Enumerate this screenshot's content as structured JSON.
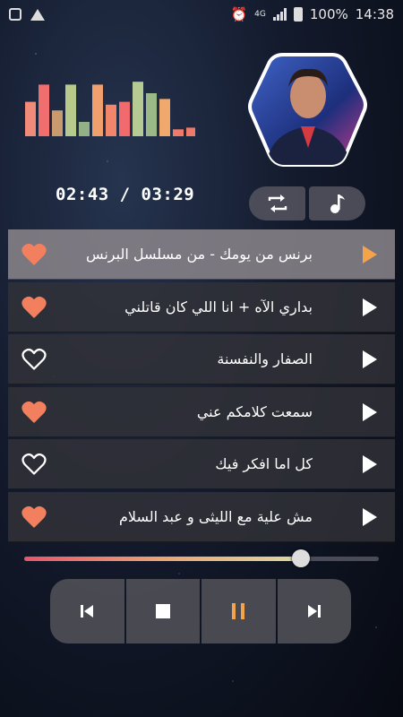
{
  "status_bar": {
    "network": "4G",
    "battery": "100%",
    "time": "14:38",
    "icons": [
      "gallery-icon",
      "drive-icon",
      "alarm-icon",
      "signal-icon",
      "battery-icon"
    ]
  },
  "player": {
    "elapsed": "02:43",
    "separator": " / ",
    "duration": "03:29",
    "progress_fraction": 0.78,
    "accent_color": "#f5a34a",
    "heart_color": "#f2805e"
  },
  "equalizer": {
    "levels": [
      0.6,
      0.9,
      0.45,
      0.9,
      0.25,
      0.9,
      0.55,
      0.6,
      0.95,
      0.75,
      0.65,
      0.12,
      0.15
    ],
    "colors": [
      "#f08a79",
      "#f06e6e",
      "#c89a6d",
      "#b7c98b",
      "#94b087",
      "#f0a06d",
      "#f2866a",
      "#f06a6e",
      "#b6cb93",
      "#9bb887",
      "#f0a86c",
      "#f07a6a",
      "#f07a6a"
    ]
  },
  "top_buttons": [
    {
      "name": "repeat-button",
      "icon": "repeat-icon"
    },
    {
      "name": "music-note-button",
      "icon": "music-note-icon"
    }
  ],
  "songs": [
    {
      "title": "برنس من يومك - من مسلسل البرنس",
      "favorite": true,
      "active": true
    },
    {
      "title": "بداري الآه + انا اللي كان قاتلني",
      "favorite": true,
      "active": false
    },
    {
      "title": "الصفار والنفسنة",
      "favorite": false,
      "active": false
    },
    {
      "title": "سمعت كلامكم عني",
      "favorite": true,
      "active": false
    },
    {
      "title": "كل اما افكر فيك",
      "favorite": false,
      "active": false
    },
    {
      "title": "مش علية مع الليثى و عبد السلام",
      "favorite": true,
      "active": false
    }
  ],
  "controls": [
    {
      "name": "previous-button",
      "icon": "skip-previous-icon"
    },
    {
      "name": "stop-button",
      "icon": "stop-icon"
    },
    {
      "name": "pause-button",
      "icon": "pause-icon"
    },
    {
      "name": "next-button",
      "icon": "skip-next-icon"
    }
  ]
}
